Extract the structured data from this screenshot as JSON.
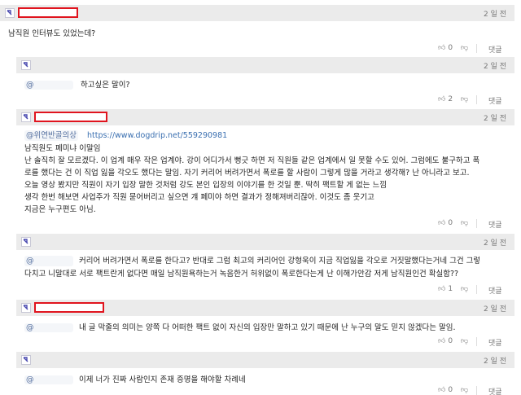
{
  "comments": [
    {
      "time": "2 일 전",
      "text": "남직원 인터뷰도 있었는데?",
      "likes": "0",
      "reply_label": "댓글"
    },
    {
      "time": "2 일 전",
      "mention": "@",
      "text": "하고싶은 말이?",
      "likes": "2",
      "reply_label": "댓글"
    },
    {
      "time": "2 일 전",
      "mention": "@위연반골의상",
      "link": "https://www.dogdrip.net/559290981",
      "lines": [
        "남직원도 페미냐 이말임",
        "난 솔직히 잘 모르겠다. 이 업계 매우 작은 업계야. 강이 어디가서 뻥긋 하면 저 직원들 같은 업계에서 일 못할 수도 있어. 그럼에도 불구하고 폭",
        "로를 했다는 건 이 직업 잃을 각오도 했다는 말임. 자기 커리어 버려가면서 폭로를 할 사람이 그렇게 많을 거라고 생각해? 난 아니라고 보고.",
        "오늘 영상 봤지만 직원이 자기 입장 말한 것처럼 강도 본인 입장의 이야기를 한 것일 뿐. 딱히 팩트할 게 없는 느낌",
        "생각 한번 해보면 사업주가 직원 묻어버리고 싶으면 걔 페미야 하면 결과가 정해져버리잖아. 이것도 좀 웃기고",
        "지금은 누구편도 아님."
      ],
      "likes": "0",
      "reply_label": "댓글"
    },
    {
      "time": "2 일 전",
      "mention": "@",
      "lines": [
        "커리어 버려가면서 폭로를 한다고? 반대로 그럼 최고의 커리어인 강형욱이 지금 직업잃을 각오로 거짓말했다는거네 그건 그렇",
        "다치고 니말대로 서로 팩트란게 없다면 매일 남직원욕하는거 녹음한거 허위없이 폭로한다는게 난 이해가안감 저게 남직원인건 확실함??"
      ],
      "likes": "1",
      "reply_label": "댓글"
    },
    {
      "time": "2 일 전",
      "mention": "@",
      "text": "내 글 막줄의 의미는 양쪽 다 어떠한 팩트 없이 자신의 입장만 말하고 있기 때문에 난 누구의 말도 믿지 않겠다는 말임.",
      "likes": "0",
      "reply_label": "댓글"
    },
    {
      "time": "2 일 전",
      "mention": "@",
      "text": "이제 너가 진짜 사람인지 존재 증명을 해야할 차례네",
      "likes": "0",
      "reply_label": "댓글"
    }
  ],
  "colors": {
    "redact": "#e0141e",
    "header_bg": "#ebebeb",
    "mention": "#3a6fb0"
  }
}
